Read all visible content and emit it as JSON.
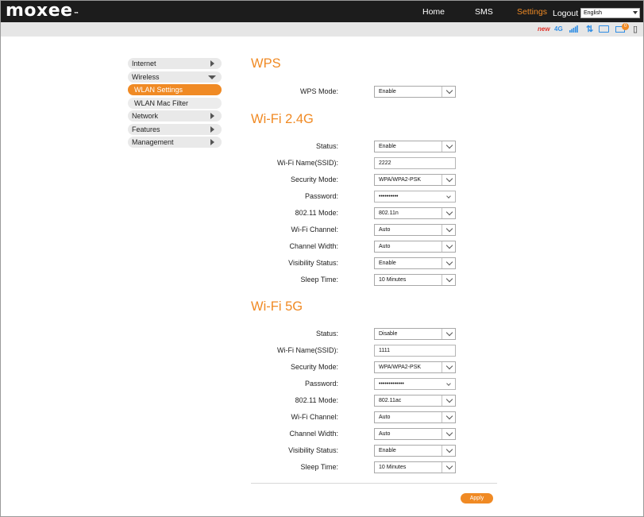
{
  "brand": {
    "logo": "moxee",
    "trademark": "™"
  },
  "topnav": {
    "home": "Home",
    "sms": "SMS",
    "settings": "Settings",
    "logout": "Logout",
    "language": "English"
  },
  "status": {
    "new_label": "new",
    "network": "4G",
    "sms_count": "0",
    "icons": [
      "signal-icon",
      "transfer-icon",
      "wifi-device-icon",
      "mail-icon",
      "sim-icon"
    ]
  },
  "sidebar": {
    "items": [
      {
        "label": "Internet"
      },
      {
        "label": "Wireless"
      },
      {
        "label": "WLAN Settings"
      },
      {
        "label": "WLAN Mac Filter"
      },
      {
        "label": "Network"
      },
      {
        "label": "Features"
      },
      {
        "label": "Management"
      }
    ]
  },
  "wps": {
    "title": "WPS",
    "mode_label": "WPS Mode:",
    "mode_value": "Enable"
  },
  "wifi24": {
    "title": "Wi-Fi 2.4G",
    "rows": [
      {
        "label": "Status:",
        "value": "Enable"
      },
      {
        "label": "Wi-Fi Name(SSID):",
        "value": "2222"
      },
      {
        "label": "Security Mode:",
        "value": "WPA/WPA2-PSK"
      },
      {
        "label": "Password:",
        "value": "••••••••••"
      },
      {
        "label": "802.11 Mode:",
        "value": "802.11n"
      },
      {
        "label": "Wi-Fi Channel:",
        "value": "Auto"
      },
      {
        "label": "Channel Width:",
        "value": "Auto"
      },
      {
        "label": "Visibility Status:",
        "value": "Enable"
      },
      {
        "label": "Sleep Time:",
        "value": "10 Minutes"
      }
    ]
  },
  "wifi5": {
    "title": "Wi-Fi 5G",
    "rows": [
      {
        "label": "Status:",
        "value": "Disable"
      },
      {
        "label": "Wi-Fi Name(SSID):",
        "value": "1111"
      },
      {
        "label": "Security Mode:",
        "value": "WPA/WPA2-PSK"
      },
      {
        "label": "Password:",
        "value": "•••••••••••••"
      },
      {
        "label": "802.11 Mode:",
        "value": "802.11ac"
      },
      {
        "label": "Wi-Fi Channel:",
        "value": "Auto"
      },
      {
        "label": "Channel Width:",
        "value": "Auto"
      },
      {
        "label": "Visibility Status:",
        "value": "Enable"
      },
      {
        "label": "Sleep Time:",
        "value": "10 Minutes"
      }
    ]
  },
  "apply_label": "Apply",
  "colors": {
    "accent": "#f08a24",
    "topbar": "#1c1c1c",
    "status_blue": "#2f8de4"
  }
}
